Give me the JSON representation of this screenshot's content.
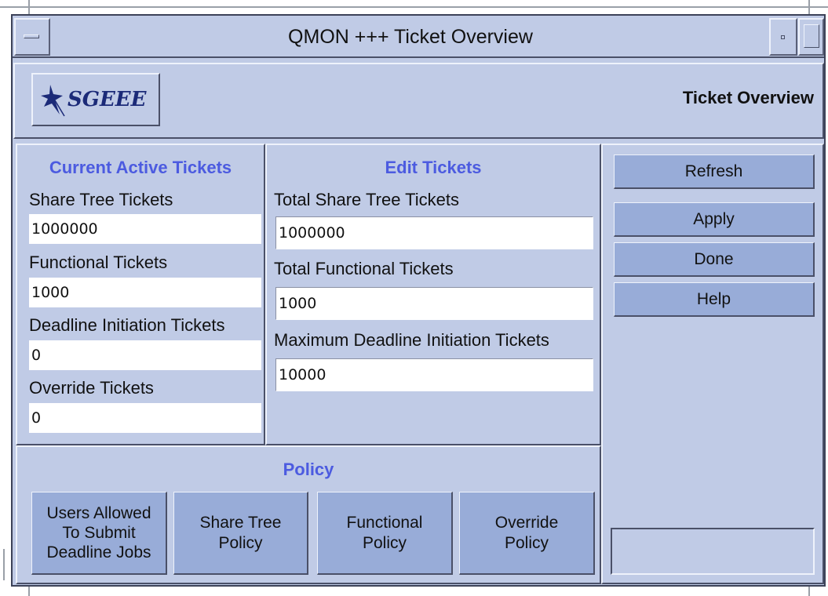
{
  "window": {
    "title": "QMON +++ Ticket Overview"
  },
  "header": {
    "logo_text": "SGEEE",
    "title": "Ticket Overview"
  },
  "current_active": {
    "title": "Current Active Tickets",
    "share_tree_label": "Share Tree Tickets",
    "share_tree_value": "1000000",
    "functional_label": "Functional Tickets",
    "functional_value": "1000",
    "deadline_label": "Deadline Initiation Tickets",
    "deadline_value": "0",
    "override_label": "Override Tickets",
    "override_value": "0"
  },
  "edit_tickets": {
    "title": "Edit Tickets",
    "total_share_tree_label": "Total Share Tree Tickets",
    "total_share_tree_value": "1000000",
    "total_functional_label": "Total Functional Tickets",
    "total_functional_value": "1000",
    "max_deadline_label": "Maximum Deadline Initiation Tickets",
    "max_deadline_value": "10000"
  },
  "actions": {
    "refresh": "Refresh",
    "apply": "Apply",
    "done": "Done",
    "help": "Help",
    "status_value": ""
  },
  "policy": {
    "title": "Policy",
    "buttons": [
      "Users Allowed\nTo Submit\nDeadline Jobs",
      "Share Tree\nPolicy",
      "Functional\nPolicy",
      "Override\nPolicy"
    ]
  },
  "colors": {
    "window_bg": "#c0cbe6",
    "button_bg": "#98acd8",
    "section_title": "#4c5be0",
    "logo_text": "#1b2a78"
  },
  "icons": {
    "logo": "bird-logo-icon",
    "window_menu": "window-menu-icon",
    "minimize": "minimize-icon",
    "maximize": "maximize-icon"
  }
}
